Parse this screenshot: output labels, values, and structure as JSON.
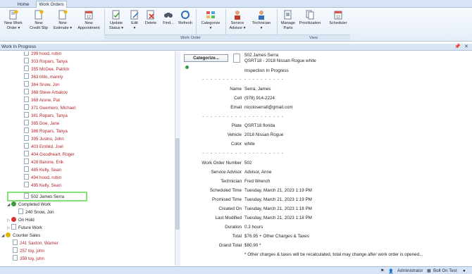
{
  "ribbon_tabs": [
    {
      "label": "Home",
      "active": false
    },
    {
      "label": "Work Orders",
      "active": true
    }
  ],
  "ribbon": {
    "buttons": [
      {
        "label": "New Work\nOrder ▾",
        "icon": "new-work-order-icon"
      },
      {
        "label": "New\nCredit Slip",
        "icon": "credit-slip-icon"
      },
      {
        "label": "New\nEstimate ▾",
        "icon": "estimate-icon"
      },
      {
        "label": "New\nAppointment",
        "icon": "calendar-icon"
      },
      {
        "label": "Update\nStatus ▾",
        "icon": "update-status-icon"
      },
      {
        "label": "Edit\n▾",
        "icon": "edit-icon"
      },
      {
        "label": "Delete",
        "icon": "delete-icon"
      },
      {
        "label": "Find...",
        "icon": "binoculars-icon"
      },
      {
        "label": "Refresh",
        "icon": "refresh-icon"
      },
      {
        "label": "Categorize\n▾",
        "icon": "categorize-icon"
      },
      {
        "label": "Service\nAdvisor ▾",
        "icon": "service-advisor-icon"
      },
      {
        "label": "Technician\n▾",
        "icon": "technician-icon"
      },
      {
        "label": "Manage\nParts",
        "icon": "manage-parts-icon"
      },
      {
        "label": "Prioritization",
        "icon": "prioritization-icon"
      },
      {
        "label": "Scheduler",
        "icon": "scheduler-icon"
      }
    ],
    "groups": {
      "work_order": "Work Order",
      "view": "View"
    }
  },
  "panel": {
    "title": "Work In Progress",
    "pin": "📌",
    "close": "✕"
  },
  "tree": {
    "items": [
      "299 hood, robin",
      "303 Ropars, Tanya",
      "355 McGee, Patrick",
      "363 trillo, manny",
      "364 Snow, Jon",
      "368 Steve Arbakov",
      "369 Arone, Pat",
      "371 Guerriero, Michael",
      "381 Ropars, Tanya",
      "385 Doe, Jane",
      "386 Ropars, Tanya",
      "395 Jusino, John",
      "403 Embiid, Joel",
      "404 Goodheart, Roger",
      "428 Barone, Erik",
      "485 Kelly, Sean",
      "494 hood, robin",
      "495 Kelly, Sean"
    ],
    "selected": "502 James Serra",
    "completed_label": "Completed Work",
    "completed_item": "240 Snow, Jon",
    "on_hold_label": "On Hold",
    "future_label": "Future Work",
    "counter_label": "Counter Sales",
    "counter_items": [
      "241 Saxton, Warner",
      "257 toy, john",
      "359 toy, john"
    ]
  },
  "detail": {
    "categorize_button": "Categorize...",
    "title": "502 James Serra",
    "vehicle_line": "QSRT18 - 2018 Nissan Rogue white",
    "status": "Inspection In Progress",
    "dashes": "- - - - - - - - - -",
    "customer": [
      {
        "label": "Name",
        "value": "Serra, James"
      },
      {
        "label": "Cell",
        "value": "(978) 914-2224"
      },
      {
        "label": "Email",
        "value": "nicoloserrall@gmail.com"
      }
    ],
    "vehicle": [
      {
        "label": "Plate",
        "value": "QSRT18 florida"
      },
      {
        "label": "Vehicle",
        "value": "2018 Nissan Rogue"
      },
      {
        "label": "Color",
        "value": "white"
      }
    ],
    "order": [
      {
        "label": "Work Order Number",
        "value": "502"
      },
      {
        "label": "Service Advisor",
        "value": "Advisor, Anne"
      },
      {
        "label": "Technician",
        "value": "Fred Wrench"
      },
      {
        "label": "Scheduled Time",
        "value": "Tuesday, March 21, 2023 1:19 PM"
      },
      {
        "label": "Promised Time",
        "value": "Tuesday, March 21, 2023 1:19 PM"
      },
      {
        "label": "Created On",
        "value": "Tuesday, March 21, 2023 1:18 PM"
      },
      {
        "label": "Last Modified",
        "value": "Tuesday, March 21, 2023 1:18 PM"
      },
      {
        "label": "Duration",
        "value": "0.3 hours"
      },
      {
        "label": "Total",
        "value": "$76.95 + Other Charges & Taxes"
      },
      {
        "label": "Grand Total",
        "value": "$80.90 *"
      }
    ],
    "footnote": "* Other charges & taxes will be recalculated, total may change after work order is opened..."
  },
  "statusbar": {
    "user": "Administrator",
    "shop": "Bolt On Test"
  },
  "colors": {
    "accent": "#d6e4f5",
    "overdue_text": "#b3242b",
    "selection_border": "#86e07a"
  }
}
